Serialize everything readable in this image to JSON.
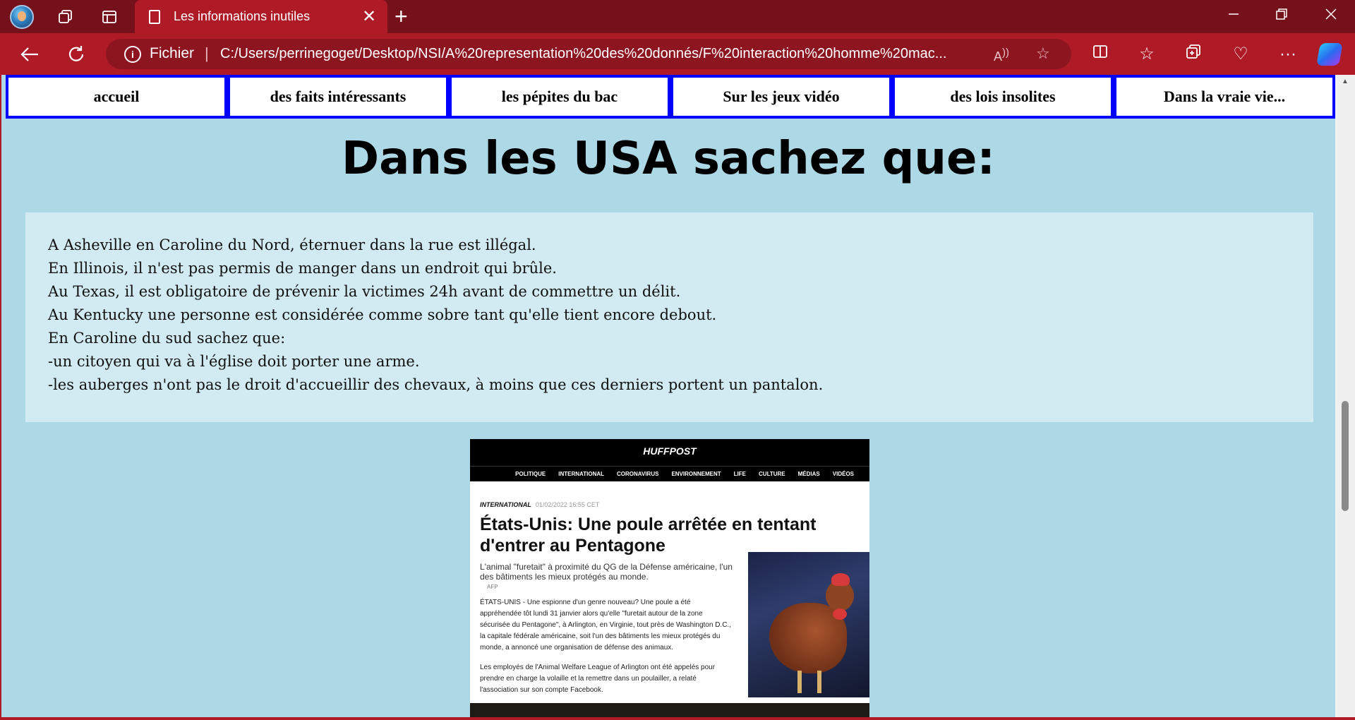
{
  "browser": {
    "tab_title": "Les informations inutiles",
    "new_tab_symbol": "+",
    "tab_close_symbol": "✕",
    "protocol_label": "Fichier",
    "url": "C:/Users/perrinegoget/Desktop/NSI/A%20representation%20des%20donnés/F%20interaction%20homme%20mac...",
    "theme_color": "#af1a27",
    "titlebar_color": "#75111a"
  },
  "nav": {
    "items": [
      {
        "label": "accueil"
      },
      {
        "label": "des faits intéressants"
      },
      {
        "label": "les pépites du bac"
      },
      {
        "label": "Sur les jeux vidéo"
      },
      {
        "label": "des lois insolites"
      },
      {
        "label": "Dans la vraie vie..."
      }
    ],
    "border_color": "#0000ff"
  },
  "page": {
    "background": "#add8e6",
    "heading": "Dans les USA sachez que:",
    "lines": [
      "A Asheville en Caroline du Nord, éternuer dans la rue est illégal.",
      "En Illinois, il n'est pas permis de manger dans un endroit qui brûle.",
      "Au Texas, il est obligatoire de prévenir la victimes 24h avant de commettre un délit.",
      "Au Kentucky une personne est considérée comme sobre tant qu'elle tient encore debout.",
      "En Caroline du sud sachez que:",
      "-un citoyen qui va à l'église doit porter une arme.",
      "-les auberges n'ont pas le droit d'accueillir des chevaux, à moins que ces derniers portent un pantalon."
    ]
  },
  "article": {
    "logo": "HUFFPOST",
    "nav": [
      "POLITIQUE",
      "INTERNATIONAL",
      "CORONAVIRUS",
      "ENVIRONNEMENT",
      "LIFE",
      "CULTURE",
      "MÉDIAS",
      "VIDÉOS"
    ],
    "section": "INTERNATIONAL",
    "date": "01/02/2022 16:55 CET",
    "headline_line1": "États-Unis: Une poule arrêtée en tentant",
    "headline_line2": "d'entrer au Pentagone",
    "subhead_line1": "L'animal \"furetait\" à proximité du QG de la Défense américaine, l'un",
    "subhead_line2": "des bâtiments les mieux protégés au monde.",
    "credit": "AFP",
    "p1": [
      "ÉTATS-UNIS - Une espionne d'un genre nouveau? Une poule a été",
      "appréhendée tôt lundi 31 janvier alors qu'elle \"furetait autour de la zone",
      "sécurisée du Pentagone\", à Arlington, en Virginie, tout près de Washington D.C.,",
      "la capitale fédérale américaine, soit l'un des bâtiments les mieux protégés du",
      "monde, a annoncé une organisation de défense des animaux."
    ],
    "p2": [
      "Les employés de l'Animal Welfare League of Arlington ont été appelés pour",
      "prendre en charge la volaille et la remettre dans un poulailler, a relaté",
      "l'association sur son compte Facebook."
    ]
  }
}
